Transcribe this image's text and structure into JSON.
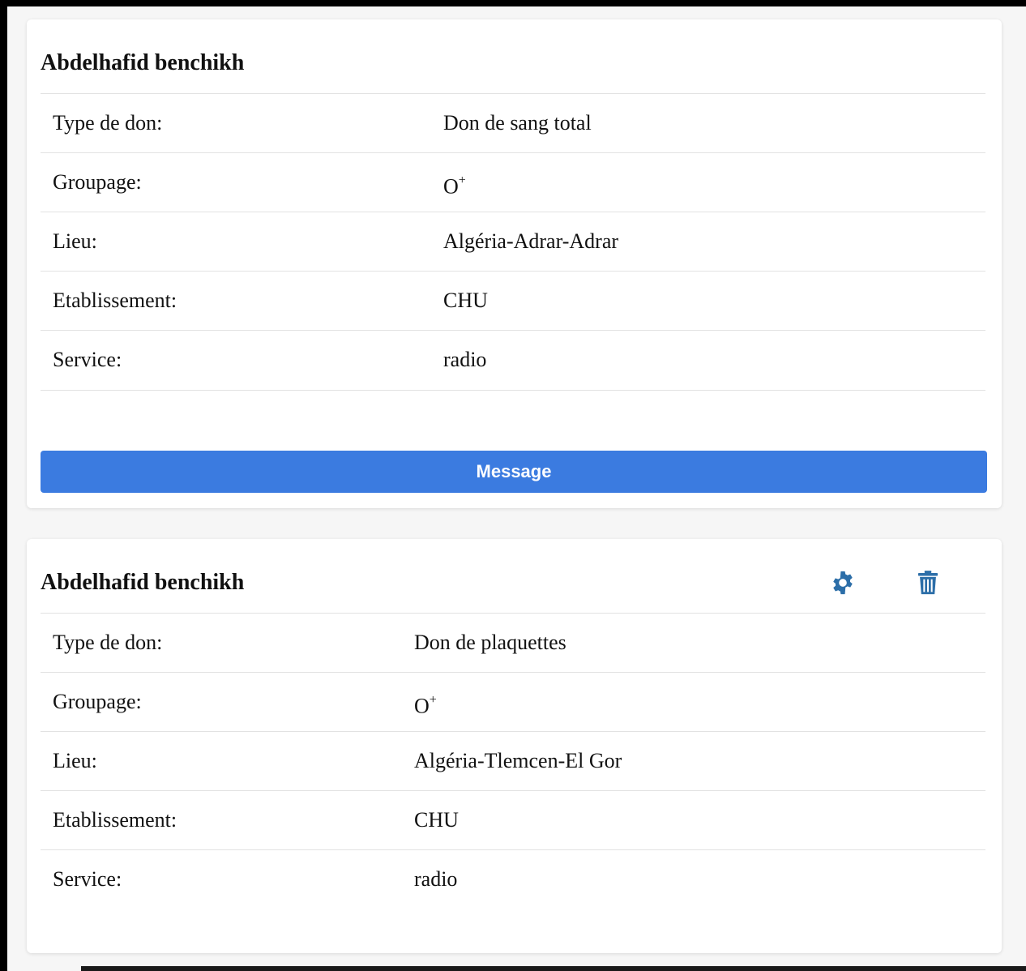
{
  "colors": {
    "accent": "#3b7be0",
    "icon_blue": "#2c6ea8",
    "divider": "#e2e2e2"
  },
  "cards": [
    {
      "name": "Abdelhafid benchikh",
      "rows": [
        {
          "label": "Type de don:",
          "value": "Don de sang total"
        },
        {
          "label": "Groupage:",
          "value": "O",
          "sup": "+"
        },
        {
          "label": "Lieu:",
          "value": "Algéria-Adrar-Adrar"
        },
        {
          "label": "Etablissement:",
          "value": "CHU"
        },
        {
          "label": "Service:",
          "value": "radio"
        }
      ],
      "button_label": "Message"
    },
    {
      "name": "Abdelhafid benchikh",
      "icons": [
        "gear-icon",
        "trash-icon"
      ],
      "rows": [
        {
          "label": "Type de don:",
          "value": "Don de plaquettes"
        },
        {
          "label": "Groupage:",
          "value": "O",
          "sup": "+"
        },
        {
          "label": "Lieu:",
          "value": "Algéria-Tlemcen-El Gor"
        },
        {
          "label": "Etablissement:",
          "value": "CHU"
        },
        {
          "label": "Service:",
          "value": "radio"
        }
      ]
    }
  ]
}
